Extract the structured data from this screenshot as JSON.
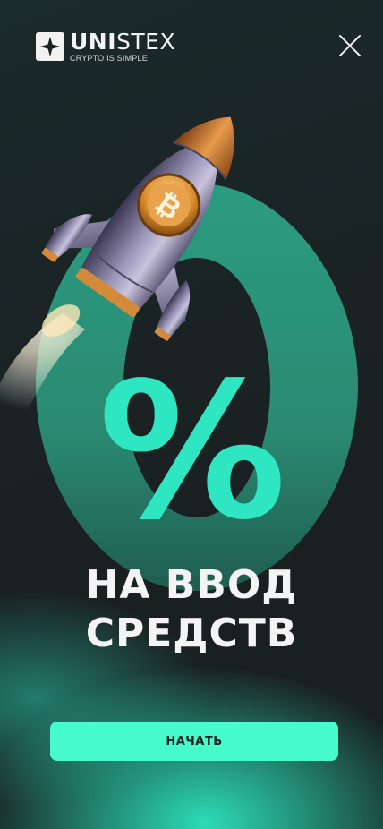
{
  "brand": {
    "name_bold": "UNI",
    "name_regular": "STEX",
    "tagline": "CRYPTO IS SIMPLE"
  },
  "promo": {
    "big_digit": "0",
    "percent_sign": "%",
    "headline_line1": "НА ВВОД",
    "headline_line2": "СРЕДСТВ"
  },
  "cta": {
    "label": "НАЧАТЬ"
  },
  "icons": {
    "close": "close-icon",
    "rocket": "bitcoin-rocket-illustration",
    "logo": "unistex-logo-icon"
  },
  "colors": {
    "accent": "#47fbcd",
    "digit": "#2a8f78",
    "percent": "#2fe6c2",
    "background": "#1a2021",
    "text": "#f4f4f4"
  }
}
